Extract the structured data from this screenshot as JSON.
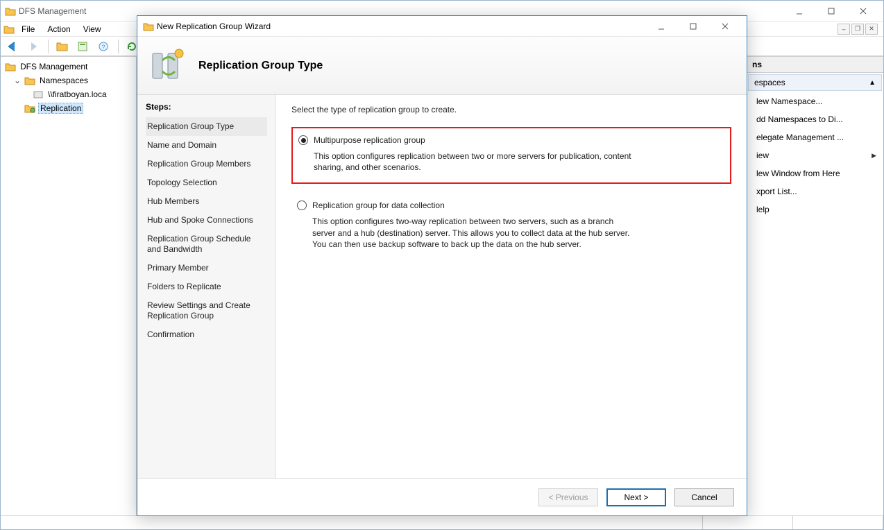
{
  "mmc": {
    "title": "DFS Management",
    "menu": {
      "file": "File",
      "action": "Action",
      "view": "View"
    },
    "tree": {
      "root": "DFS Management",
      "namespaces": "Namespaces",
      "ns_entry": "\\\\firatboyan.loca",
      "replication": "Replication"
    }
  },
  "actions": {
    "header": "ns",
    "group": "espaces",
    "items": [
      "lew Namespace...",
      "dd Namespaces to Di...",
      "elegate Management ...",
      "iew",
      "lew Window from Here",
      "xport List...",
      "lelp"
    ],
    "submenu_index": 3
  },
  "wizard": {
    "title": "New Replication Group Wizard",
    "heading": "Replication Group Type",
    "steps_title": "Steps:",
    "steps": [
      "Replication Group Type",
      "Name and Domain",
      "Replication Group Members",
      "Topology Selection",
      "Hub Members",
      "Hub and Spoke Connections",
      "Replication Group Schedule and Bandwidth",
      "Primary Member",
      "Folders to Replicate",
      "Review Settings and Create Replication Group",
      "Confirmation"
    ],
    "current_step_index": 0,
    "prompt": "Select the type of replication group to create.",
    "options": [
      {
        "label": "Multipurpose replication group",
        "desc": "This option configures replication between two or more servers for publication, content sharing, and other scenarios.",
        "checked": true,
        "highlight": true
      },
      {
        "label": "Replication group for data collection",
        "desc": "This option configures two-way replication between two servers, such as a branch server and a hub (destination) server. This allows you to collect data at the hub server. You can then use backup software to back up the data on the hub server.",
        "checked": false,
        "highlight": false
      }
    ],
    "buttons": {
      "prev": "< Previous",
      "next": "Next >",
      "cancel": "Cancel"
    }
  }
}
